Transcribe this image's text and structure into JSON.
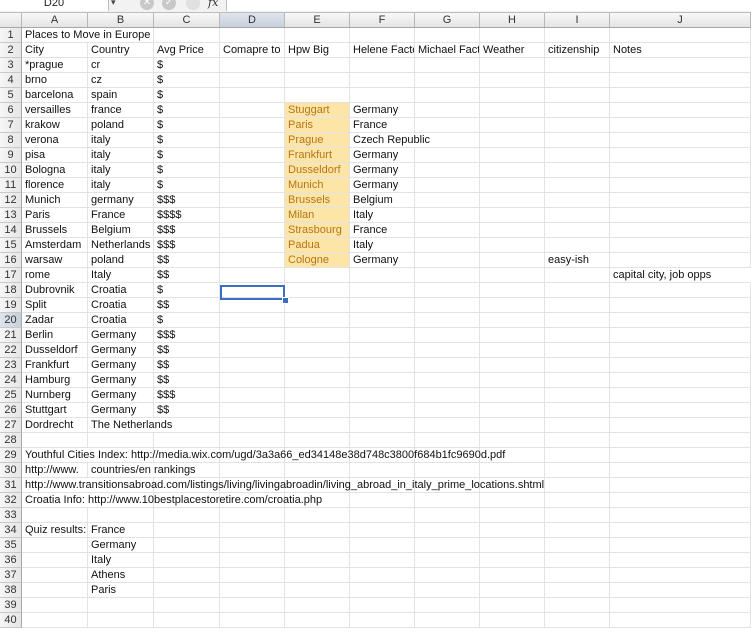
{
  "formula_bar": {
    "name_box": "D20",
    "fx": "fx",
    "formula": ""
  },
  "columns": [
    "A",
    "B",
    "C",
    "D",
    "E",
    "F",
    "G",
    "H",
    "I",
    "J"
  ],
  "selected_column": "D",
  "selected_row": 20,
  "rows": [
    {
      "n": "1",
      "A": "Places to Move in Europe"
    },
    {
      "n": "2",
      "A": "City",
      "B": "Country",
      "C": "Avg Price",
      "D": "Comapre to I",
      "E": "Hpw Big",
      "F": "Helene Facto",
      "G": "Michael Fact",
      "H": "Weather",
      "I": "citizenship",
      "J": "Notes"
    },
    {
      "n": "3",
      "A": "*prague",
      "B": "cr",
      "C": "$"
    },
    {
      "n": "4",
      "A": "brno",
      "B": "cz",
      "C": "$"
    },
    {
      "n": "5",
      "A": "barcelona",
      "B": "spain",
      "C": "$"
    },
    {
      "n": "6",
      "A": "versailles",
      "B": "france",
      "C": "$",
      "E": "Stuggart",
      "F": "Germany"
    },
    {
      "n": "7",
      "A": "krakow",
      "B": "poland",
      "C": "$",
      "E": "Paris",
      "F": "France"
    },
    {
      "n": "8",
      "A": "verona",
      "B": "italy",
      "C": "$",
      "E": "Prague",
      "F": "Czech Republic"
    },
    {
      "n": "9",
      "A": "pisa",
      "B": "italy",
      "C": "$",
      "E": "Frankfurt",
      "F": "Germany"
    },
    {
      "n": "10",
      "A": "Bologna",
      "B": "italy",
      "C": "$",
      "E": "Dusseldorf",
      "F": "Germany"
    },
    {
      "n": "11",
      "A": "florence",
      "B": "italy",
      "C": "$",
      "E": "Munich",
      "F": "Germany"
    },
    {
      "n": "12",
      "A": "Munich",
      "B": "germany",
      "C": "$$$",
      "E": "Brussels",
      "F": "Belgium"
    },
    {
      "n": "13",
      "A": "Paris",
      "B": "France",
      "C": "$$$$",
      "E": "Milan",
      "F": "Italy"
    },
    {
      "n": "14",
      "A": "Brussels",
      "B": "Belgium",
      "C": "$$$",
      "E": "Strasbourg",
      "F": "France"
    },
    {
      "n": "15",
      "A": "Amsterdam",
      "B": "Netherlands",
      "C": "$$$",
      "E": "Padua",
      "F": "Italy"
    },
    {
      "n": "16",
      "A": "warsaw",
      "B": "poland",
      "C": "$$",
      "E": "Cologne",
      "F": "Germany",
      "I": "easy-ish"
    },
    {
      "n": "17",
      "A": "rome",
      "B": "Italy",
      "C": "$$",
      "J": "capital city, job opps"
    },
    {
      "n": "18",
      "A": "Dubrovnik",
      "B": "Croatia",
      "C": "$"
    },
    {
      "n": "19",
      "A": "Split",
      "B": "Croatia",
      "C": "$$"
    },
    {
      "n": "20",
      "A": "Zadar",
      "B": "Croatia",
      "C": "$"
    },
    {
      "n": "21",
      "A": "Berlin",
      "B": "Germany",
      "C": "$$$"
    },
    {
      "n": "22",
      "A": "Dusseldorf",
      "B": "Germany",
      "C": "$$"
    },
    {
      "n": "23",
      "A": "Frankfurt",
      "B": "Germany",
      "C": "$$"
    },
    {
      "n": "24",
      "A": "Hamburg",
      "B": "Germany",
      "C": "$$"
    },
    {
      "n": "25",
      "A": "Nurnberg",
      "B": "Germany",
      "C": "$$$"
    },
    {
      "n": "26",
      "A": "Stuttgart",
      "B": "Germany",
      "C": "$$"
    },
    {
      "n": "27",
      "A": "Dordrecht",
      "B": "The Netherlands"
    },
    {
      "n": "28"
    },
    {
      "n": "29",
      "A": "Youthful Cities Index: http://media.wix.com/ugd/3a3a66_ed34148e38d748c3800f684b1fc9690d.pdf"
    },
    {
      "n": "30",
      "A": "http://www.",
      "B": "countries/en rankings"
    },
    {
      "n": "31",
      "A": "http://www.transitionsabroad.com/listings/living/livingabroadin/living_abroad_in_italy_prime_locations.shtml"
    },
    {
      "n": "32",
      "A": "Croatia Info: http://www.10bestplacestoretire.com/croatia.php"
    },
    {
      "n": "33"
    },
    {
      "n": "34",
      "A": "Quiz results:",
      "B": "France"
    },
    {
      "n": "35",
      "B": "Germany"
    },
    {
      "n": "36",
      "B": "Italy"
    },
    {
      "n": "37",
      "B": "Athens"
    },
    {
      "n": "38",
      "B": "Paris"
    },
    {
      "n": "39"
    },
    {
      "n": "40"
    }
  ],
  "highlight": {
    "column": "E",
    "rows_from": 6,
    "rows_to": 16,
    "fill_color": "#fde5a8",
    "text_color": "#b57515"
  },
  "selection_color": "#3a6fc4"
}
